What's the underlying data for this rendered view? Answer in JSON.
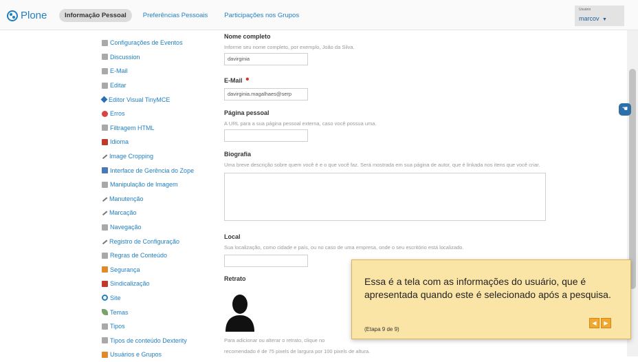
{
  "brand": {
    "name": "Plone"
  },
  "tabs": [
    {
      "label": "Informação Pessoal",
      "active": true
    },
    {
      "label": "Preferências Pessoais",
      "active": false
    },
    {
      "label": "Participações nos Grupos",
      "active": false
    }
  ],
  "user": {
    "caption": "Usuário",
    "name": "marcov",
    "caret": "▼"
  },
  "sidebar": {
    "items": [
      {
        "label": "Configurações de Eventos",
        "icon": "calendar-icon"
      },
      {
        "label": "Discussion",
        "icon": "discussion-icon"
      },
      {
        "label": "E-Mail",
        "icon": "mail-icon"
      },
      {
        "label": "Editar",
        "icon": "edit-icon"
      },
      {
        "label": "Editor Visual TinyMCE",
        "icon": "tinymce-icon"
      },
      {
        "label": "Erros",
        "icon": "error-icon"
      },
      {
        "label": "Filtragem HTML",
        "icon": "filter-icon"
      },
      {
        "label": "Idioma",
        "icon": "language-icon"
      },
      {
        "label": "Image Cropping",
        "icon": "crop-icon"
      },
      {
        "label": "Interface de Gerência do Zope",
        "icon": "zope-icon"
      },
      {
        "label": "Manipulação de Imagem",
        "icon": "image-icon"
      },
      {
        "label": "Manutenção",
        "icon": "maintenance-icon"
      },
      {
        "label": "Marcação",
        "icon": "markup-icon"
      },
      {
        "label": "Navegação",
        "icon": "navigation-icon"
      },
      {
        "label": "Registro de Configuração",
        "icon": "registry-icon"
      },
      {
        "label": "Regras de Conteúdo",
        "icon": "rules-icon"
      },
      {
        "label": "Segurança",
        "icon": "security-icon"
      },
      {
        "label": "Sindicalização",
        "icon": "syndication-icon"
      },
      {
        "label": "Site",
        "icon": "site-icon"
      },
      {
        "label": "Temas",
        "icon": "themes-icon"
      },
      {
        "label": "Tipos",
        "icon": "types-icon"
      },
      {
        "label": "Tipos de conteúdo Dexterity",
        "icon": "dexterity-icon"
      },
      {
        "label": "Usuários e Grupos",
        "icon": "users-icon"
      }
    ]
  },
  "form": {
    "fullname": {
      "label": "Nome completo",
      "help": "Informe seu nome completo, por exemplo, João da Silva.",
      "value": "davirginia"
    },
    "email": {
      "label": "E-Mail",
      "required_mark": "•",
      "value": "davirginia.magalhaes@serp"
    },
    "homepage": {
      "label": "Página pessoal",
      "help": "A URL para a sua página pessoal externa, caso você possua uma.",
      "value": ""
    },
    "bio": {
      "label": "Biografia",
      "help": "Uma breve descrição sobre quem você é e o que você faz. Será mostrada em sua página de autor, que é linkada nos itens que você criar."
    },
    "location": {
      "label": "Local",
      "help": "Sua localização, como cidade e país, ou no caso de uma empresa, onde o seu escritório está localizado.",
      "value": ""
    },
    "portrait": {
      "label": "Retrato",
      "help_line1": "Para adicionar ou alterar o retrato, clique no",
      "help_line2": "recomendado é de 75 pixels de largura por 100 pixels de altura."
    }
  },
  "tour": {
    "message": "Essa é a tela com as informações do usuário, que é apresentada quando este é selecionado após a pesquisa.",
    "step": "(Etapa 9 de 9)",
    "prev_label": "◀",
    "next_label": "▶"
  },
  "colors": {
    "link": "#1f7fc2",
    "tooltip_bg": "#fbe5a6",
    "tour_button": "#f0a830"
  }
}
